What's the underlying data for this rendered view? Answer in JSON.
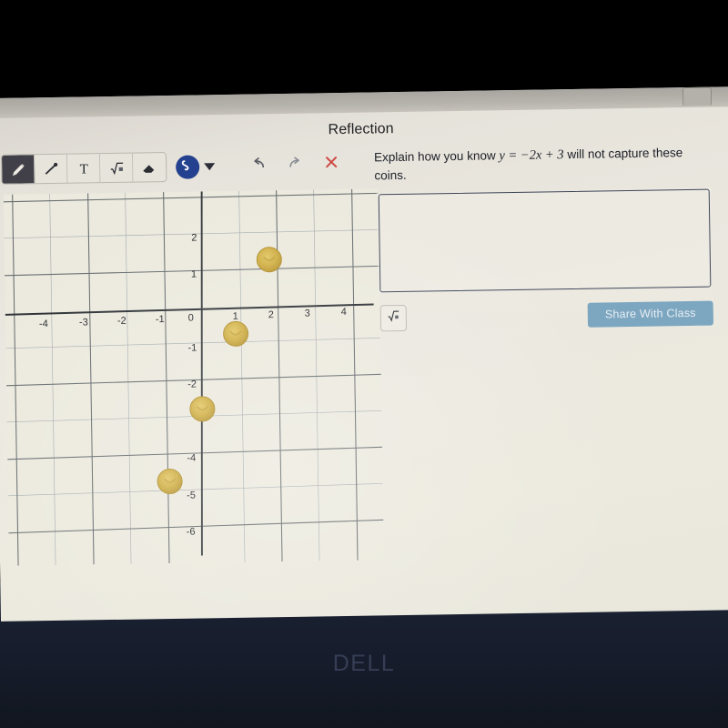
{
  "device": {
    "brand_logo": "DELL"
  },
  "header": {
    "title": "Reflection",
    "top_pill_icon": "window-control-icon"
  },
  "toolbar": {
    "tools": [
      {
        "name": "pencil-tool",
        "icon": "pencil-icon",
        "label": "Pencil",
        "active": true
      },
      {
        "name": "line-tool",
        "icon": "line-icon",
        "label": "Line",
        "active": false
      },
      {
        "name": "text-tool",
        "icon": "text-icon",
        "label": "T",
        "active": false
      },
      {
        "name": "math-tool",
        "icon": "sqrt-icon",
        "label": "Math",
        "active": false
      },
      {
        "name": "eraser-tool",
        "icon": "eraser-icon",
        "label": "Eraser",
        "active": false
      }
    ],
    "color_picker": {
      "label": "Stroke color",
      "icon": "squiggle-icon",
      "color": "#24418f"
    },
    "color_dropdown": {
      "label": "Open color menu",
      "icon": "chevron-down-icon"
    },
    "undo": {
      "label": "Undo",
      "icon": "undo-arrow-icon"
    },
    "redo": {
      "label": "Redo",
      "icon": "redo-arrow-icon"
    },
    "clear": {
      "label": "Clear",
      "icon": "close-x-icon",
      "color": "#cf4a43"
    }
  },
  "prompt": {
    "text_before": "Explain how you know",
    "equation": "y = −2x + 3",
    "text_after": "will not capture these coins."
  },
  "answer": {
    "value": "",
    "placeholder": "",
    "math_button": {
      "label": "Insert math",
      "icon": "sqrt-icon"
    },
    "share_button": {
      "label": "Share With Class",
      "color": "#7da7c0"
    }
  },
  "chart_data": {
    "type": "scatter",
    "title": "",
    "xlabel": "",
    "ylabel": "",
    "xlim": [
      -4.6,
      4.6
    ],
    "ylim": [
      -6.8,
      2.8
    ],
    "grid": true,
    "xticks": [
      -4,
      -3,
      -2,
      -1,
      0,
      1,
      2,
      3,
      4
    ],
    "xtick_labels": [
      "-4",
      "-3",
      "-2",
      "-1",
      "0",
      "1",
      "2",
      "3",
      "4"
    ],
    "yticks": [
      2,
      1,
      -1,
      -2,
      -4,
      -5,
      -6
    ],
    "ytick_labels": [
      "2",
      "1",
      "-1",
      "-2",
      "-4",
      "-5",
      "-6"
    ],
    "origin_label": "0",
    "series": [
      {
        "name": "coins",
        "marker": "coin",
        "color": "#cda93f",
        "points": [
          {
            "x": 2,
            "y": 1,
            "label": "coin at (2, 1)"
          },
          {
            "x": 1,
            "y": -1,
            "label": "coin at (1, -1)"
          },
          {
            "x": 0,
            "y": -3,
            "label": "coin at (0, -3)"
          },
          {
            "x": -1,
            "y": -5,
            "label": "coin at (-1, -5)"
          }
        ]
      }
    ],
    "reference_line": {
      "equation": "y = -2x + 3",
      "slope": -2,
      "intercept": 3,
      "drawn": false
    }
  }
}
